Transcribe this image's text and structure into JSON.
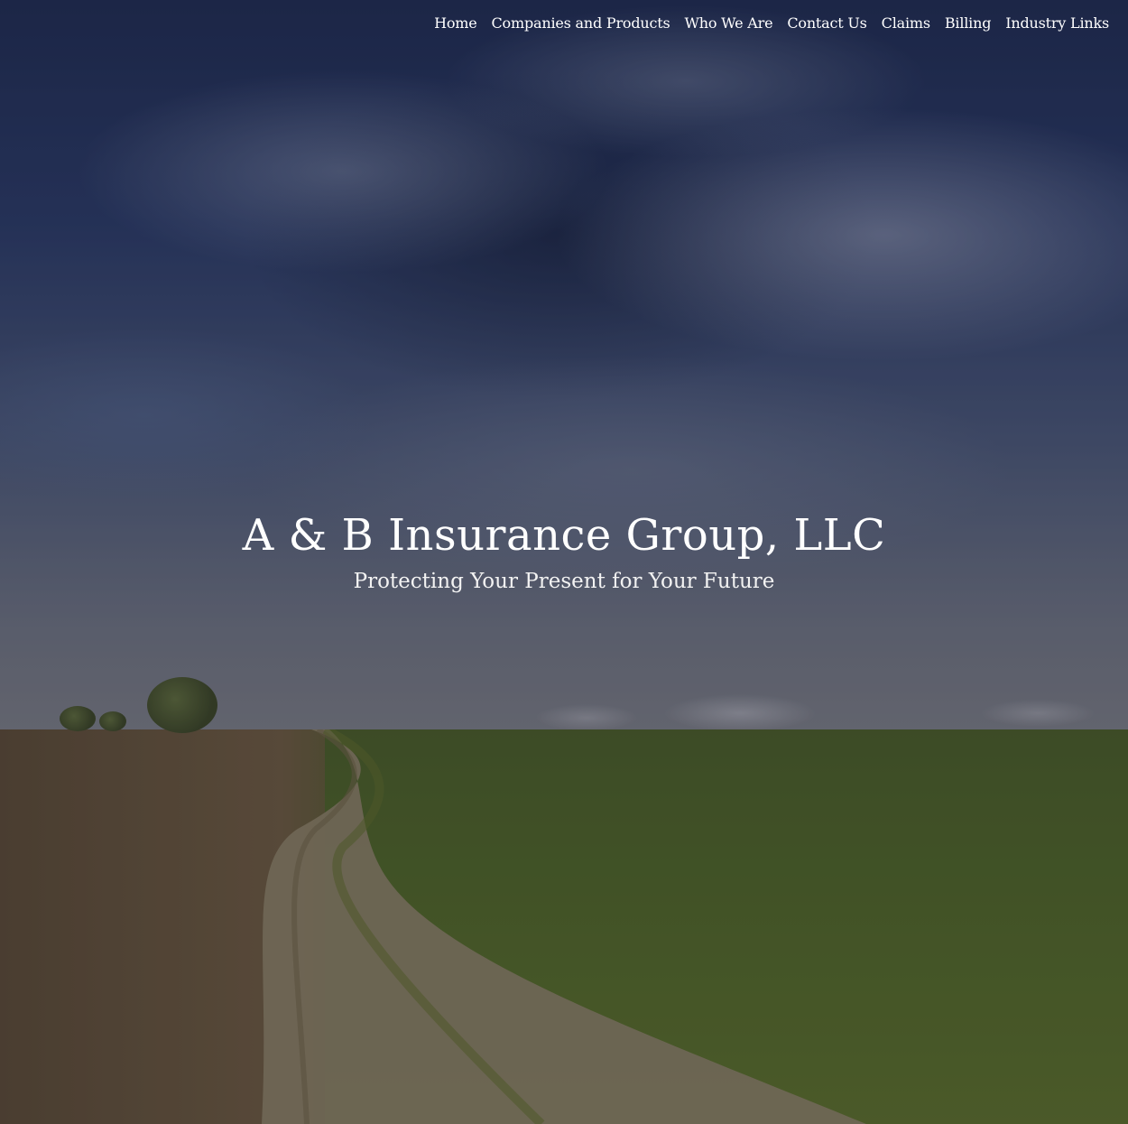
{
  "nav": {
    "items": [
      {
        "label": "Home"
      },
      {
        "label": "Companies and Products"
      },
      {
        "label": "Who We Are"
      },
      {
        "label": "Contact Us"
      },
      {
        "label": "Claims"
      },
      {
        "label": "Billing"
      },
      {
        "label": "Industry Links"
      }
    ]
  },
  "hero": {
    "title": "A & B Insurance Group, LLC",
    "tagline": "Protecting Your Present for Your Future",
    "background_description_icon": "landscape-image"
  },
  "colors": {
    "text": "#ffffff",
    "sky": "#2a3a66",
    "grass": "#4f6528",
    "soil": "#6b5940"
  }
}
